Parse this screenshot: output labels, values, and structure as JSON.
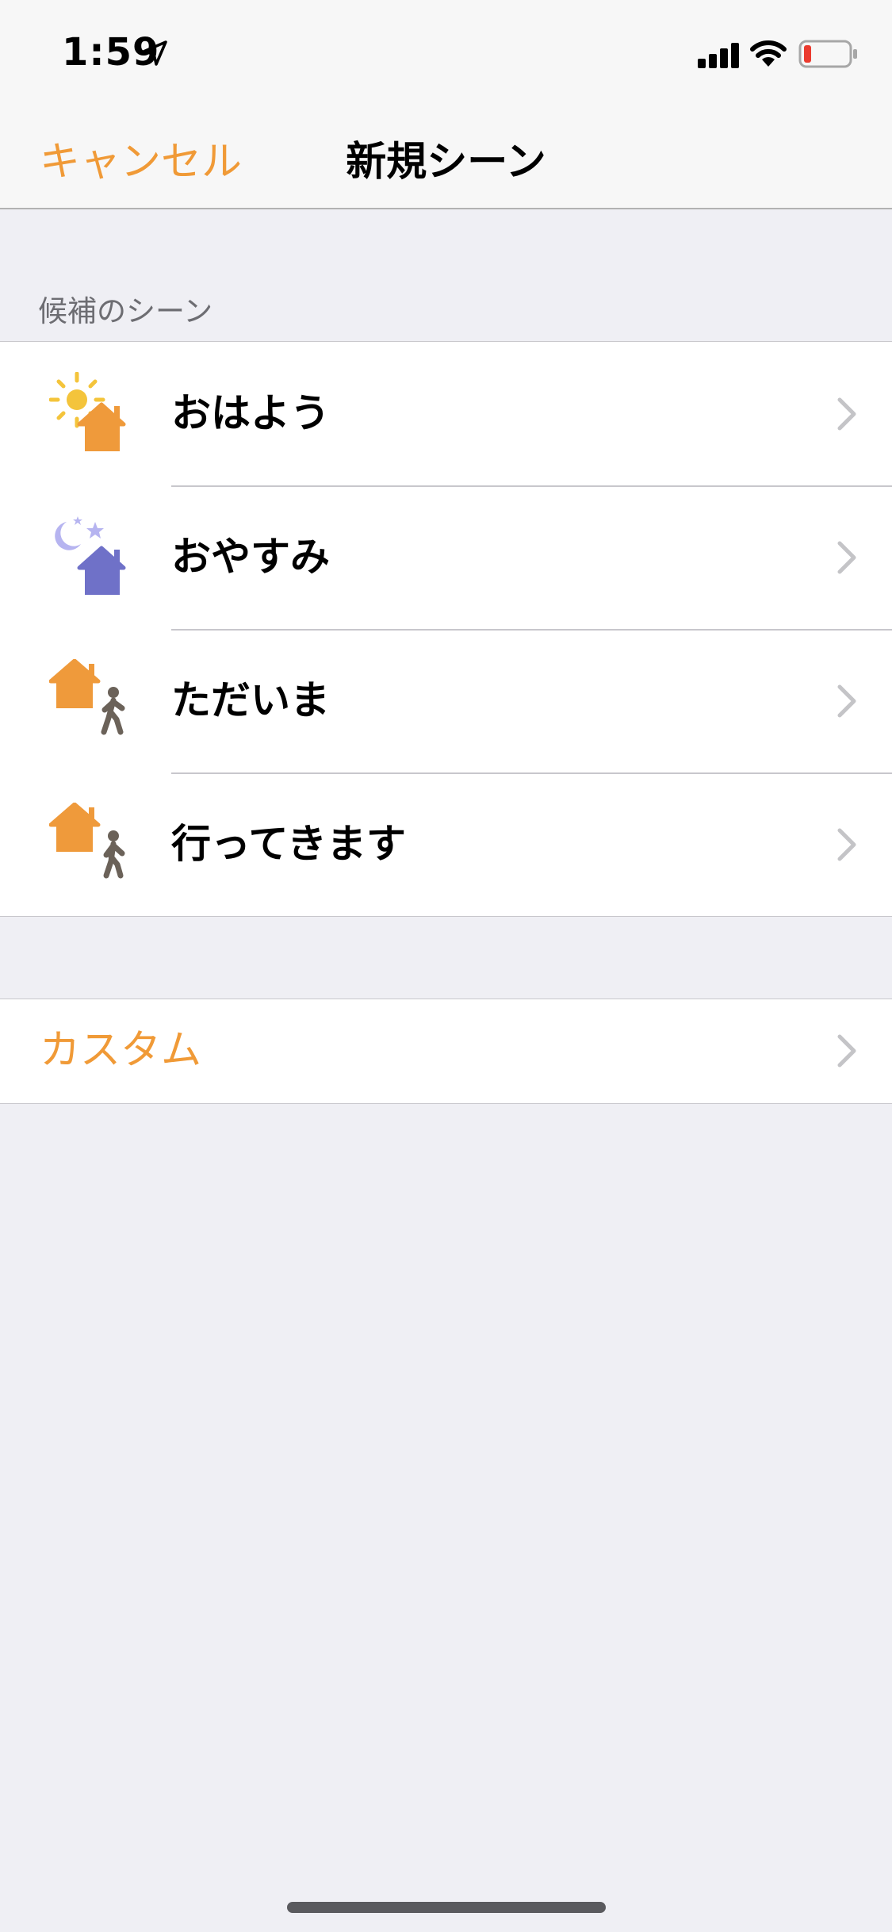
{
  "status_bar": {
    "time": "1:59",
    "location_icon": "location-arrow-icon",
    "signal_icon": "cellular-signal-icon",
    "wifi_icon": "wifi-icon",
    "battery_icon": "battery-low-icon"
  },
  "nav": {
    "cancel_label": "キャンセル",
    "title": "新規シーン"
  },
  "suggested": {
    "header": "候補のシーン",
    "items": [
      {
        "label": "おはよう",
        "icon": "sun-house-icon"
      },
      {
        "label": "おやすみ",
        "icon": "moon-house-icon"
      },
      {
        "label": "ただいま",
        "icon": "arrive-home-icon"
      },
      {
        "label": "行ってきます",
        "icon": "leave-home-icon"
      }
    ]
  },
  "custom": {
    "label": "カスタム"
  },
  "colors": {
    "accent": "#f09a37",
    "house_orange": "#ef9a3b",
    "house_purple": "#6f71c8",
    "moon_lavender": "#b6b4f0",
    "sun_yellow": "#f4c43b",
    "person_gray": "#6b6259",
    "battery_red": "#eb3b2f",
    "background": "#efeff4"
  }
}
